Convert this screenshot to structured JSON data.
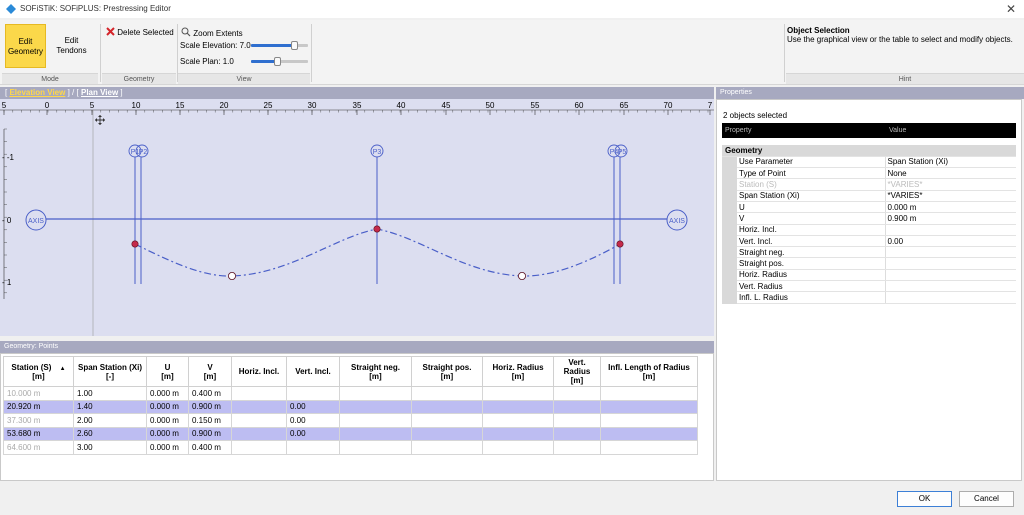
{
  "window": {
    "title": "SOFiSTiK: SOFiPLUS: Prestressing Editor",
    "close": "✕",
    "accent": "#2a8ad8"
  },
  "ribbon": {
    "mode": {
      "label": "Mode",
      "edit_geometry": "Edit Geometry",
      "edit_tendons": "Edit Tendons"
    },
    "geometry": {
      "label": "Geometry",
      "delete_selected": "Delete Selected"
    },
    "view": {
      "label": "View",
      "zoom_extents": "Zoom Extents",
      "scale_elevation": "Scale Elevation: 7.0",
      "scale_plan": "Scale Plan: 1.0",
      "scale_elevation_level": 0.85,
      "scale_plan_level": 0.5
    },
    "hint": {
      "label": "Hint",
      "title": "Object Selection",
      "text": "Use the graphical view or the table to select and modify objects."
    }
  },
  "viewtabs": {
    "open1": "[",
    "elevation": "Elevation View",
    "close1": "]",
    "slash": "/",
    "open2": "[",
    "plan": "Plan View",
    "close2": "]"
  },
  "graphic": {
    "ruler_ticks": [
      "5",
      "0",
      "5",
      "10",
      "15",
      "20",
      "25",
      "30",
      "35",
      "40",
      "45",
      "50",
      "55",
      "60",
      "65",
      "70",
      "7"
    ],
    "y_labels": [
      "- -1",
      "- 0",
      "- 1"
    ],
    "axis_label": "AXIS",
    "points": [
      "P1",
      "P2",
      "P3",
      "P4",
      "P5"
    ]
  },
  "table": {
    "title": "Geometry: Points",
    "columns": [
      {
        "name": "Station (S)",
        "unit": "[m]"
      },
      {
        "name": "Span Station (Xi)",
        "unit": "[-]"
      },
      {
        "name": "U",
        "unit": "[m]"
      },
      {
        "name": "V",
        "unit": "[m]"
      },
      {
        "name": "Horiz. Incl.",
        "unit": ""
      },
      {
        "name": "Vert. Incl.",
        "unit": ""
      },
      {
        "name": "Straight neg.",
        "unit": "[m]"
      },
      {
        "name": "Straight pos.",
        "unit": "[m]"
      },
      {
        "name": "Horiz. Radius",
        "unit": "[m]"
      },
      {
        "name": "Vert. Radius",
        "unit": "[m]"
      },
      {
        "name": "Infl. Length of Radius",
        "unit": "[m]"
      }
    ],
    "sort_indicator": "▲",
    "rows": [
      {
        "station": "10.000 m",
        "xi": "1.00",
        "u": "0.000 m",
        "v": "0.400 m",
        "hincl": "",
        "vincl": "",
        "selected": false
      },
      {
        "station": "20.920 m",
        "xi": "1.40",
        "u": "0.000 m",
        "v": "0.900 m",
        "hincl": "",
        "vincl": "0.00",
        "selected": true
      },
      {
        "station": "37.300 m",
        "xi": "2.00",
        "u": "0.000 m",
        "v": "0.150 m",
        "hincl": "",
        "vincl": "0.00",
        "selected": false
      },
      {
        "station": "53.680 m",
        "xi": "2.60",
        "u": "0.000 m",
        "v": "0.900 m",
        "hincl": "",
        "vincl": "0.00",
        "selected": true
      },
      {
        "station": "64.600 m",
        "xi": "3.00",
        "u": "0.000 m",
        "v": "0.400 m",
        "hincl": "",
        "vincl": "",
        "selected": false
      }
    ]
  },
  "properties": {
    "title": "Properties",
    "count": "2 objects selected",
    "header_property": "Property",
    "header_value": "Value",
    "category": "Geometry",
    "rows": [
      {
        "name": "Use Parameter",
        "value": "Span Station (Xi)",
        "disabled": false
      },
      {
        "name": "Type of Point",
        "value": "None",
        "disabled": false
      },
      {
        "name": "Station (S)",
        "value": "*VARIES*",
        "disabled": true
      },
      {
        "name": "Span Station (Xi)",
        "value": "*VARIES*",
        "disabled": false
      },
      {
        "name": "U",
        "value": "0.000 m",
        "disabled": false
      },
      {
        "name": "V",
        "value": "0.900 m",
        "disabled": false
      },
      {
        "name": "Horiz. Incl.",
        "value": "",
        "disabled": false
      },
      {
        "name": "Vert. Incl.",
        "value": "0.00",
        "disabled": false
      },
      {
        "name": "Straight neg.",
        "value": "",
        "disabled": false
      },
      {
        "name": "Straight pos.",
        "value": "",
        "disabled": false
      },
      {
        "name": "Horiz. Radius",
        "value": "",
        "disabled": false
      },
      {
        "name": "Vert. Radius",
        "value": "",
        "disabled": false
      },
      {
        "name": "Infl. L. Radius",
        "value": "",
        "disabled": false
      }
    ]
  },
  "footer": {
    "ok": "OK",
    "cancel": "Cancel"
  }
}
